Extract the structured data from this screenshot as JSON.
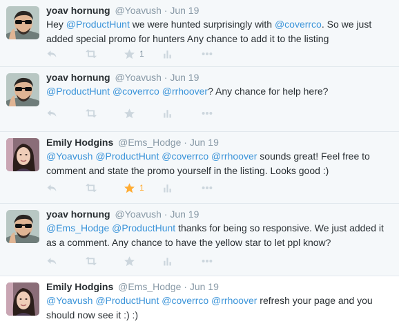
{
  "colors": {
    "mention": "#3b94d9",
    "meta": "#8899a6",
    "favorited": "#ffac33",
    "action_icon": "#ccd6dd"
  },
  "tweets": [
    {
      "fullname": "yoav hornung",
      "username": "@Yoavush",
      "sep": "·",
      "time": "Jun 19",
      "line1": [
        {
          "t": "Hey ",
          "m": false
        },
        {
          "t": "@ProductHunt",
          "m": true
        },
        {
          "t": " we were hunted surprisingly with ",
          "m": false
        },
        {
          "t": "@coverrco",
          "m": true
        },
        {
          "t": ". So we just",
          "m": false
        }
      ],
      "line2": [
        {
          "t": "added special promo for hunters Any chance to add it to the listing",
          "m": false
        }
      ],
      "favorites": "1",
      "favorited": false
    },
    {
      "fullname": "yoav hornung",
      "username": "@Yoavush",
      "sep": "·",
      "time": "Jun 19",
      "line1": [
        {
          "t": "@ProductHunt",
          "m": true
        },
        {
          "t": " ",
          "m": false
        },
        {
          "t": "@coverrco",
          "m": true
        },
        {
          "t": " ",
          "m": false
        },
        {
          "t": "@rrhoover",
          "m": true
        },
        {
          "t": "? Any chance for help here?",
          "m": false
        }
      ],
      "favorites": "",
      "favorited": false
    },
    {
      "fullname": "Emily Hodgins",
      "username": "@Ems_Hodge",
      "sep": "·",
      "time": "Jun 19",
      "line1": [
        {
          "t": "@Yoavush",
          "m": true
        },
        {
          "t": " ",
          "m": false
        },
        {
          "t": "@ProductHunt",
          "m": true
        },
        {
          "t": " ",
          "m": false
        },
        {
          "t": "@coverrco",
          "m": true
        },
        {
          "t": " ",
          "m": false
        },
        {
          "t": "@rrhoover",
          "m": true
        },
        {
          "t": " sounds great! Feel free to",
          "m": false
        }
      ],
      "line2": [
        {
          "t": "comment and state the promo yourself in the listing. Looks good :)",
          "m": false
        }
      ],
      "favorites": "1",
      "favorited": true
    },
    {
      "fullname": "yoav hornung",
      "username": "@Yoavush",
      "sep": "·",
      "time": "Jun 19",
      "line1": [
        {
          "t": "@Ems_Hodge",
          "m": true
        },
        {
          "t": " ",
          "m": false
        },
        {
          "t": "@ProductHunt",
          "m": true
        },
        {
          "t": "  thanks for being so responsive. We just added it",
          "m": false
        }
      ],
      "line2": [
        {
          "t": "as a comment. Any chance to have the yellow star to let ppl know?",
          "m": false
        }
      ],
      "favorites": "",
      "favorited": false
    },
    {
      "fullname": "Emily Hodgins",
      "username": "@Ems_Hodge",
      "sep": "·",
      "time": "Jun 19",
      "line1": [
        {
          "t": "@Yoavush",
          "m": true
        },
        {
          "t": " ",
          "m": false
        },
        {
          "t": "@ProductHunt",
          "m": true
        },
        {
          "t": " ",
          "m": false
        },
        {
          "t": "@coverrco",
          "m": true
        },
        {
          "t": " ",
          "m": false
        },
        {
          "t": "@rrhoover",
          "m": true
        },
        {
          "t": " refresh your page and you",
          "m": false
        }
      ],
      "line2": [
        {
          "t": "should now see it :) :)",
          "m": false
        }
      ]
    }
  ]
}
